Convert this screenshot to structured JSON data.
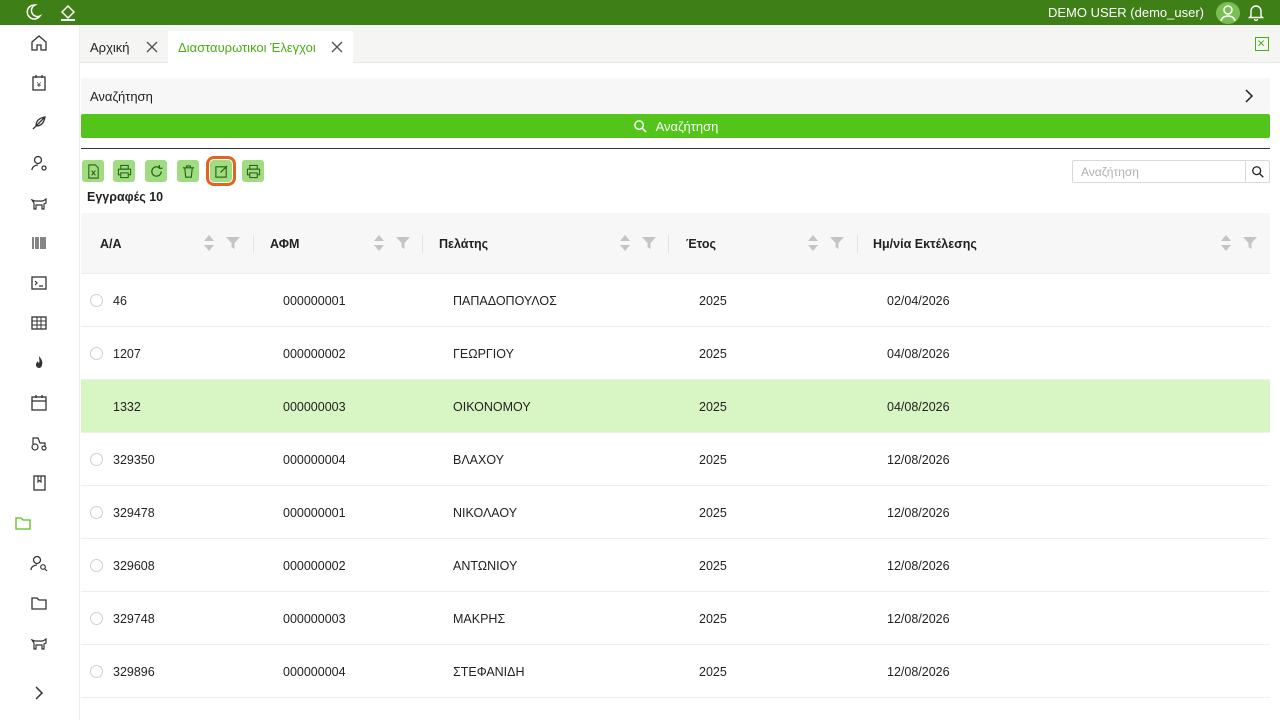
{
  "topbar": {
    "user_label": "DEMO USER (demo_user)",
    "icons": [
      "moon-icon",
      "paint-bucket-icon",
      "user-avatar-icon",
      "bell-icon"
    ],
    "color": "#3f7f17"
  },
  "sidebar": {
    "items": [
      {
        "name": "home-icon"
      },
      {
        "name": "calendar-tax-icon"
      },
      {
        "name": "feather-icon"
      },
      {
        "name": "user-settings-icon"
      },
      {
        "name": "animal-icon"
      },
      {
        "name": "barcode-icon"
      },
      {
        "name": "terminal-icon"
      },
      {
        "name": "table-icon"
      },
      {
        "name": "flame-icon"
      },
      {
        "name": "calendar-icon"
      },
      {
        "name": "tractor-icon"
      },
      {
        "name": "book-icon"
      },
      {
        "name": "folder-active-icon"
      },
      {
        "name": "user-search-icon"
      },
      {
        "name": "folder-icon"
      },
      {
        "name": "cow-icon"
      },
      {
        "name": "expand-chevron-icon"
      }
    ]
  },
  "tabs": [
    {
      "label": "Αρχική"
    },
    {
      "label": "Διασταυρωτικοι Έλεγχοι"
    }
  ],
  "search_panel": {
    "label": "Αναζήτηση",
    "button_label": "Αναζήτηση"
  },
  "toolbar": {
    "buttons": [
      "excel-export-icon",
      "print-icon",
      "refresh-icon",
      "delete-icon",
      "edit-icon",
      "print-alt-icon"
    ],
    "search_placeholder": "Αναζήτηση",
    "records_label": "Εγγραφές 10"
  },
  "table": {
    "columns": [
      "Α/Α",
      "ΑΦΜ",
      "Πελάτης",
      "Έτος",
      "Ημ/νία Εκτέλεσης"
    ],
    "rows": [
      {
        "aa": "46",
        "afm": "000000001",
        "client": "ΠΑΠΑΔΟΠΟΥΛΟΣ",
        "year": "2025",
        "date": "02/04/2026",
        "selected": false
      },
      {
        "aa": "1207",
        "afm": "000000002",
        "client": "ΓΕΩΡΓΙΟΥ",
        "year": "2025",
        "date": "04/08/2026",
        "selected": false
      },
      {
        "aa": "1332",
        "afm": "000000003",
        "client": "ΟΙΚΟΝΟΜΟΥ",
        "year": "2025",
        "date": "04/08/2026",
        "selected": true
      },
      {
        "aa": "329350",
        "afm": "000000004",
        "client": "ΒΛΑΧΟΥ",
        "year": "2025",
        "date": "12/08/2026",
        "selected": false
      },
      {
        "aa": "329478",
        "afm": "000000001",
        "client": "ΝΙΚΟΛΑΟΥ",
        "year": "2025",
        "date": "12/08/2026",
        "selected": false
      },
      {
        "aa": "329608",
        "afm": "000000002",
        "client": "ΑΝΤΩΝΙΟΥ",
        "year": "2025",
        "date": "12/08/2026",
        "selected": false
      },
      {
        "aa": "329748",
        "afm": "000000003",
        "client": "ΜΑΚΡΗΣ",
        "year": "2025",
        "date": "12/08/2026",
        "selected": false
      },
      {
        "aa": "329896",
        "afm": "000000004",
        "client": "ΣΤΕΦΑΝΙΔΗ",
        "year": "2025",
        "date": "12/08/2026",
        "selected": false
      }
    ]
  },
  "colors": {
    "accent": "#52c41a",
    "selected_row": "#d8f5c4",
    "tool_bg": "#9fdc82",
    "active_outline": "#e2641e"
  }
}
